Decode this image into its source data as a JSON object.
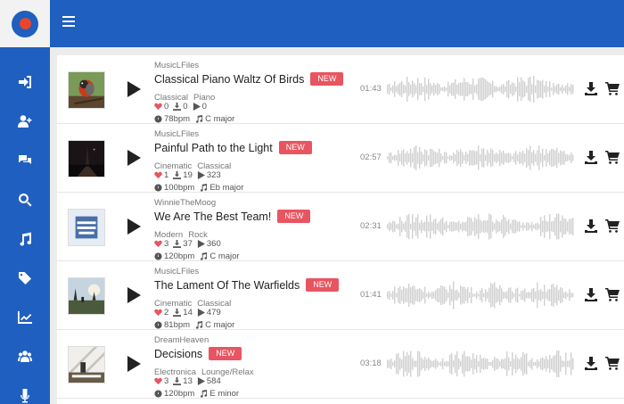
{
  "colors": {
    "brand": "#1f5fbf",
    "logo_dot": "#e8462a",
    "new_badge": "#e85560",
    "waveform": "#d0d0d0"
  },
  "sidebar": {
    "items": [
      {
        "name": "login-icon"
      },
      {
        "name": "add-user-icon"
      },
      {
        "name": "comments-icon"
      },
      {
        "name": "search-icon"
      },
      {
        "name": "music-icon"
      },
      {
        "name": "tag-icon"
      },
      {
        "name": "chart-icon"
      },
      {
        "name": "users-icon"
      },
      {
        "name": "microphone-icon"
      }
    ]
  },
  "tracks": [
    {
      "artist": "MusicLFiles",
      "title": "Classical Piano Waltz Of Birds",
      "badge": "NEW",
      "tags": [
        "Classical",
        "Piano"
      ],
      "likes": "0",
      "downloads": "0",
      "plays": "0",
      "bpm": "78bpm",
      "key": "C major",
      "duration": "01:43",
      "cover": "bird"
    },
    {
      "artist": "MusicLFiles",
      "title": "Painful Path to the Light",
      "badge": "NEW",
      "tags": [
        "Cinematic",
        "Classical"
      ],
      "likes": "1",
      "downloads": "19",
      "plays": "323",
      "bpm": "100bpm",
      "key": "Eb major",
      "duration": "02:57",
      "cover": "night"
    },
    {
      "artist": "WinnieTheMoog",
      "title": "We Are The Best Team!",
      "badge": "NEW",
      "tags": [
        "Modern",
        "Rock"
      ],
      "likes": "3",
      "downloads": "37",
      "plays": "360",
      "bpm": "120bpm",
      "key": "C major",
      "duration": "02:31",
      "cover": "team"
    },
    {
      "artist": "MusicLFiles",
      "title": "The Lament Of The Warfields",
      "badge": "NEW",
      "tags": [
        "Cinematic",
        "Classical"
      ],
      "likes": "2",
      "downloads": "14",
      "plays": "479",
      "bpm": "81bpm",
      "key": "C major",
      "duration": "01:41",
      "cover": "field"
    },
    {
      "artist": "DreamHeaven",
      "title": "Decisions",
      "badge": "NEW",
      "tags": [
        "Electronica",
        "Lounge/Relax"
      ],
      "likes": "3",
      "downloads": "13",
      "plays": "584",
      "bpm": "120bpm",
      "key": "E minor",
      "duration": "03:18",
      "cover": "stripes"
    }
  ]
}
